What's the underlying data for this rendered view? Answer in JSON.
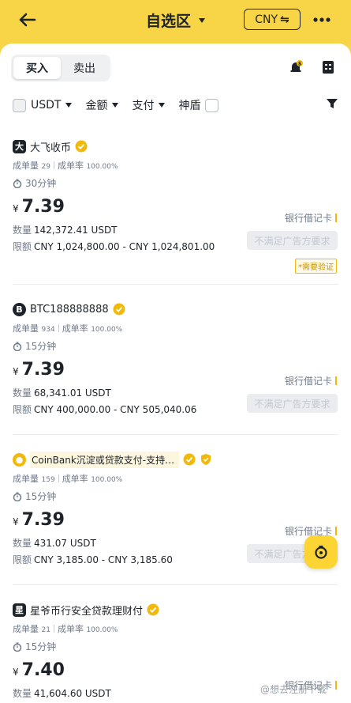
{
  "header": {
    "title": "自选区",
    "currency": "CNY",
    "currency_swap_glyph": "⇋",
    "back_icon": "arrow-left-icon",
    "more_icon": "more-dots-icon"
  },
  "tabs": [
    {
      "label": "买入",
      "active": true
    },
    {
      "label": "卖出",
      "active": false
    }
  ],
  "toolbar_icons": [
    "bell-dollar-icon",
    "order-list-icon"
  ],
  "filters": {
    "asset": "USDT",
    "amount": "金额",
    "payment": "支付",
    "shield": "神盾"
  },
  "listings": [
    {
      "avatar": "大",
      "name": "大飞收币",
      "orders_label": "成单量",
      "orders": "29",
      "rate_label": "成单率",
      "rate": "100.00%",
      "time": "30分钟",
      "currency_symbol": "¥",
      "price": "7.39",
      "qty_label": "数量",
      "qty": "142,372.41 USDT",
      "limit_label": "限额",
      "limit": "CNY 1,024,800.00 - CNY 1,024,801.00",
      "payment": "银行借记卡",
      "button": "不满足广告方要求",
      "tag": "*需要验证"
    },
    {
      "avatar": "B",
      "name": "BTC188888888",
      "orders_label": "成单量",
      "orders": "934",
      "rate_label": "成单率",
      "rate": "100.00%",
      "time": "15分钟",
      "currency_symbol": "¥",
      "price": "7.39",
      "qty_label": "数量",
      "qty": "68,341.01 USDT",
      "limit_label": "限额",
      "limit": "CNY 400,000.00 - CNY 505,040.06",
      "payment": "银行借记卡",
      "button": "不满足广告方要求"
    },
    {
      "avatar": "●",
      "name": "CoinBank沉淀或贷款支付-支持…",
      "orders_label": "成单量",
      "orders": "159",
      "rate_label": "成单率",
      "rate": "100.00%",
      "time": "15分钟",
      "currency_symbol": "¥",
      "price": "7.39",
      "qty_label": "数量",
      "qty": "431.07 USDT",
      "limit_label": "限额",
      "limit": "CNY 3,185.00 - CNY 3,185.60",
      "payment": "银行借记卡",
      "button": "不满足广告方要求"
    },
    {
      "avatar": "星",
      "name": "星爷币行安全贷款理财付",
      "orders_label": "成单量",
      "orders": "21",
      "rate_label": "成单率",
      "rate": "100.00%",
      "time": "15分钟",
      "currency_symbol": "¥",
      "price": "7.40",
      "qty_label": "数量",
      "qty": "41,604.60 USDT",
      "payment": "银行借记卡"
    }
  ],
  "watermark": "@想去注册下载",
  "colors": {
    "brand_yellow": "#f8d547",
    "accent": "#f0b90b",
    "text": "#1e2329",
    "muted": "#707a8a"
  }
}
